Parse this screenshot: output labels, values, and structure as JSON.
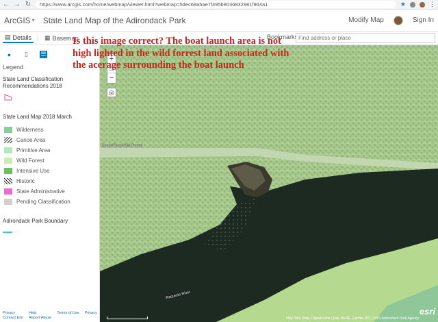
{
  "browser": {
    "url": "https://www.arcgis.com/home/webmap/viewer.html?webmap=5dec68a5ae7f495b8036832981f964a1"
  },
  "header": {
    "logo": "ArcGIS",
    "title": "State Land Map of the Adirondack Park",
    "modify_map": "Modify Map",
    "sign_in": "Sign In"
  },
  "toolbar": {
    "details": "Details",
    "basemap": "Basemap",
    "bookmarks": "Bookmarks",
    "search_placeholder": "Find address or place"
  },
  "panel": {
    "legend_heading": "Legend",
    "layer1_title": "State Land Classification Recommendations 2018",
    "layer2_title": "State Land Map 2018 March",
    "layer3_title": "Adirondack Park Boundary",
    "legend_items": [
      {
        "label": "Wilderness",
        "color": "#7fd29a"
      },
      {
        "label": "Canoe Area",
        "color": "hatch"
      },
      {
        "label": "Primitive Area",
        "color": "#b8e6c2"
      },
      {
        "label": "Wild Forest",
        "color": "#c9ecb2"
      },
      {
        "label": "Intensive Use",
        "color": "#6fbf5a"
      },
      {
        "label": "Historic",
        "color": "hatch-dark"
      },
      {
        "label": "State Administrative",
        "color": "#e86fd0"
      },
      {
        "label": "Pending Classification",
        "color": "#cfcfcf"
      }
    ],
    "footer": [
      "Privacy",
      "Help",
      "Terms of Use",
      "Privacy",
      "Contact Esri",
      "Report Abuse"
    ]
  },
  "map": {
    "label_forest": "Round Pond Wild Forest",
    "label_water": "Raquette River",
    "attribution": "New York State, DigitalGlobe | Esri, HERE, Garmin, IPC | NYS Adirondack Park Agency",
    "esri": "esri"
  },
  "annotation": "Is this image correct? The boat launch area is not high lighted in the wild forrest land associated with the acerage surrounding the boat launch",
  "colors": {
    "accent": "#0079c1",
    "annotation": "#d41f1f",
    "forest_overlay": "#b5d98f",
    "water": "#1d2a22"
  }
}
